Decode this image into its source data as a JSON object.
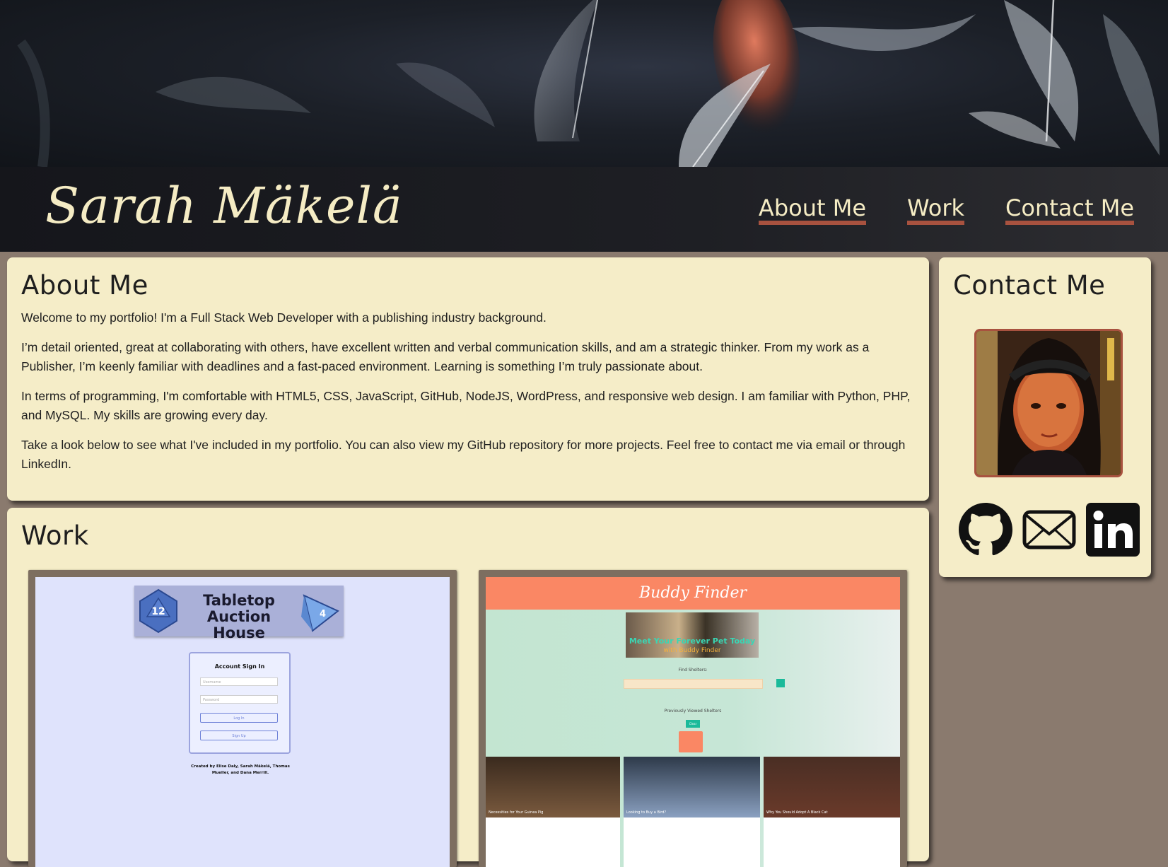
{
  "header": {
    "site_title": "Sarah Mäkelä",
    "nav": [
      "About Me",
      "Work",
      "Contact Me"
    ]
  },
  "about": {
    "heading": "About Me",
    "paragraphs": [
      "Welcome to my portfolio! I'm a Full Stack Web Developer with a publishing industry background.",
      "I’m detail oriented, great at collaborating with others, have excellent written and verbal communication skills, and am a strategic thinker. From my work as a Publisher, I’m keenly familiar with deadlines and a fast-paced environment. Learning is something I’m truly passionate about.",
      "In terms of programming, I'm comfortable with HTML5, CSS, JavaScript, GitHub, NodeJS, WordPress, and responsive web design. I am familiar with Python, PHP, and MySQL. My skills are growing every day.",
      "Take a look below to see what I've included in my portfolio. You can also view my GitHub repository for more projects. Feel free to contact me via email or through LinkedIn."
    ]
  },
  "contact": {
    "heading": "Contact Me",
    "icons": [
      "github-icon",
      "email-icon",
      "linkedin-icon"
    ]
  },
  "work": {
    "heading": "Work",
    "projects": [
      {
        "title_line1": "Tabletop Auction",
        "title_line2": "House",
        "die1": "12",
        "die2": "4",
        "signin_title": "Account Sign In",
        "username_placeholder": "Username",
        "password_placeholder": "Password",
        "login_label": "Log In",
        "signup_label": "Sign Up",
        "credits_line1": "Created by Elise Daly, Sarah Mäkelä, Thomas",
        "credits_line2": "Mueller, and Dana Merrill."
      },
      {
        "title": "Buddy Finder",
        "banner_line1": "Meet Your Forever Pet Today",
        "banner_line2": "with Buddy Finder",
        "find_label": "Find Shelters:",
        "prev_label": "Previously Viewed Shelters",
        "clear_label": "Clear",
        "tile_captions": [
          "Necessities for Your Guinea Pig",
          "Looking to Buy a Bird?",
          "Why You Should Adopt A Black Cat"
        ]
      }
    ]
  },
  "colors": {
    "accent": "#a8523f",
    "panel": "#f5edc8",
    "cream_text": "#f5ecc4",
    "page_bg": "#8a7a6e",
    "coral": "#fa8764"
  }
}
